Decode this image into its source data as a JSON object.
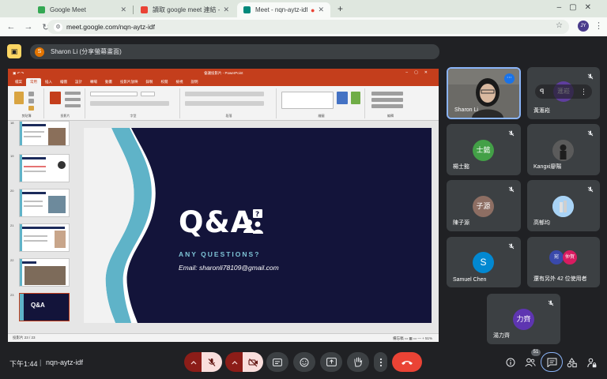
{
  "browser": {
    "tabs": [
      {
        "title": "Google Meet",
        "active": false
      },
      {
        "title": "讀取 google meet 連結 - 318...",
        "active": false
      },
      {
        "title": "Meet - nqn-aytz-idf",
        "active": true
      }
    ],
    "new_tab_label": "+",
    "url": "meet.google.com/nqn-aytz-idf",
    "profile_label": "JY"
  },
  "meet_top": {
    "presenter_initial": "S",
    "presenter_label": "Sharon Li (分享螢幕畫面)"
  },
  "powerpoint": {
    "window_title": "會議投影片 - PowerPoint",
    "menu_tabs": [
      "檔案",
      "常用",
      "插入",
      "繪圖",
      "設計",
      "轉場",
      "動畫",
      "投影片放映",
      "錄製",
      "校閱",
      "檢視",
      "說明"
    ],
    "ribbon_groups": [
      "剪貼簿",
      "投影片",
      "字型",
      "段落",
      "繪圖",
      "編輯"
    ],
    "thumbnail_numbers": [
      "18",
      "19",
      "20",
      "21",
      "22",
      "23"
    ],
    "slide": {
      "title": "Q&A",
      "subtitle": "ANY QUESTIONS?",
      "email": "Email: sharonli78109@gmail.com"
    },
    "status_left": "投影片 23 / 23",
    "status_right": "備忘稿   ▭ ▦ ▭   —  +  51%"
  },
  "participants": [
    {
      "name": "Sharon Li",
      "avatar": "",
      "color": "",
      "self": true
    },
    {
      "name": "黃滙崧",
      "avatar": "滙崧",
      "color": "#5f3e9e",
      "pinned_label": "ꟼ"
    },
    {
      "name": "楊士懿",
      "avatar": "士懿",
      "color": "#43a047"
    },
    {
      "name": "Kangxi廖陽",
      "avatar": "",
      "color": "#4a4a4a"
    },
    {
      "name": "陳子源",
      "avatar": "子源",
      "color": "#8d6e63"
    },
    {
      "name": "高郁均",
      "avatar": "",
      "color": "#90caf9"
    },
    {
      "name": "Samuel Chen",
      "avatar": "S",
      "color": "#0288d1"
    },
    {
      "name": "還有另外 42 位使用者",
      "avatar_a": "宛",
      "avatar_b": "仲賀",
      "color_a": "#3949ab",
      "color_b": "#d81b60"
    },
    {
      "name": "湯力齊",
      "avatar": "力齊",
      "color": "#5e35b1"
    }
  ],
  "bottom": {
    "time": "下午1:44",
    "separator": "|",
    "meeting_code": "nqn-aytz-idf",
    "participant_badge": "51"
  },
  "colors": {
    "meet_bg": "#202124",
    "tile_bg": "#3c4043",
    "accent": "#8ab4f8",
    "hangup": "#ea4335",
    "ppt_red": "#c43e1c",
    "slide_bg": "#13143a",
    "slide_teal": "#5fb3c8"
  }
}
